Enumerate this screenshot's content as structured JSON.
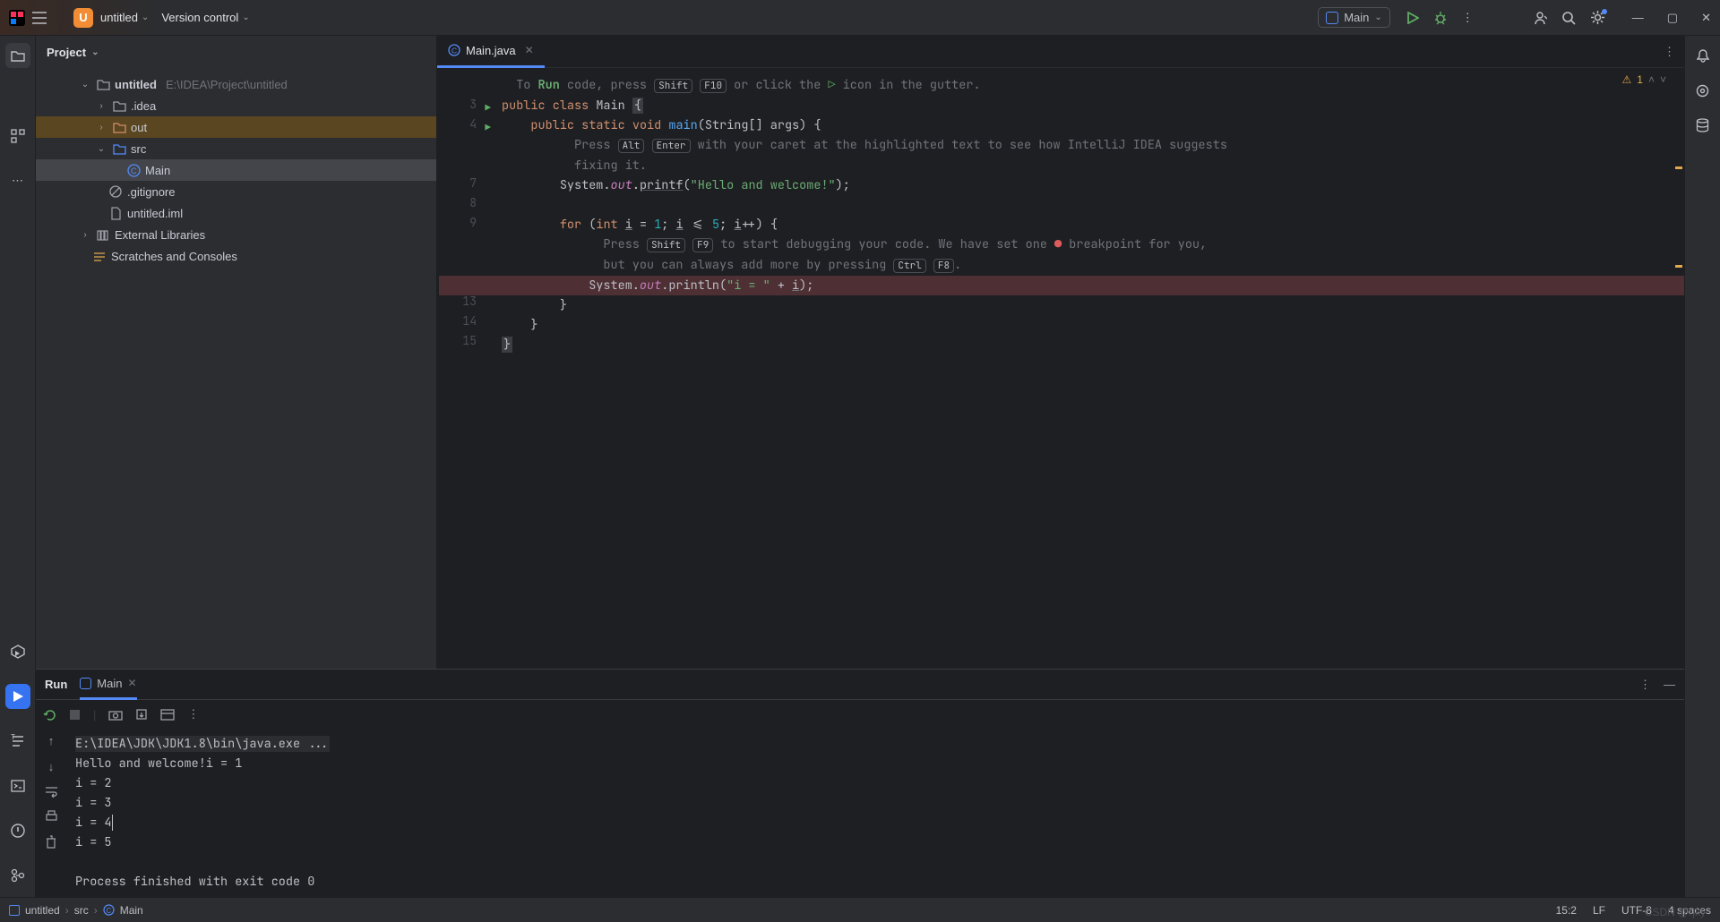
{
  "titlebar": {
    "project_initial": "U",
    "project_name": "untitled",
    "vcs_label": "Version control",
    "run_config": "Main"
  },
  "window": {
    "minimize": "—",
    "maximize": "▢",
    "close": "✕"
  },
  "project_tool": {
    "title": "Project",
    "root": {
      "name": "untitled",
      "path": "E:\\IDEA\\Project\\untitled"
    },
    "idea_folder": ".idea",
    "out_folder": "out",
    "src_folder": "src",
    "main_file": "Main",
    "gitignore": ".gitignore",
    "iml": "untitled.iml",
    "external_libs": "External Libraries",
    "scratches": "Scratches and Consoles"
  },
  "editor": {
    "tab_name": "Main.java",
    "inspection_count": "1",
    "hint_run": {
      "pre": "To ",
      "run": "Run",
      "mid": " code, press ",
      "k1": "Shift",
      "k2": "F10",
      "post": " or click the ",
      "post2": " icon in the gutter."
    },
    "hint_alt": {
      "pre": "Press ",
      "k1": "Alt",
      "k2": "Enter",
      "post": " with your caret at the highlighted text to see how IntelliJ IDEA suggests",
      "line2": "fixing it."
    },
    "hint_dbg": {
      "pre": "Press ",
      "k1": "Shift",
      "k2": "F9",
      "mid": " to start debugging your code. We have set one ",
      "mid2": " breakpoint for you,",
      "line2_pre": "but you can always add more by pressing ",
      "k3": "Ctrl",
      "k4": "F8",
      "dot": "."
    },
    "code": {
      "l3a": "public",
      "l3b": "class",
      "l3c": "Main",
      "l3d": "{",
      "l4a": "public",
      "l4b": "static",
      "l4c": "void",
      "l4d": "main",
      "l4e": "(String[] args) {",
      "l7a": "System.",
      "l7b": "out",
      "l7c": ".",
      "l7d": "printf",
      "l7e": "(",
      "l7f": "\"Hello and welcome!\"",
      "l7g": ");",
      "l9a": "for",
      "l9b": "(",
      "l9c": "int",
      "l9d": "i",
      "l9e": " = ",
      "l9f": "1",
      "l9g": "; ",
      "l9h": "i",
      "l9i": " <= ",
      "l9j": "5",
      "l9k": "; ",
      "l9l": "i",
      "l9m": "++) {",
      "l12a": "System.",
      "l12b": "out",
      "l12c": ".println(",
      "l12d": "\"i = \"",
      "l12e": " + ",
      "l12f": "i",
      "l12g": ");",
      "l13": "}",
      "l14": "}",
      "l15": "}"
    },
    "gutter": {
      "n3": "3",
      "n4": "4",
      "n7": "7",
      "n8": "8",
      "n9": "9",
      "n13": "13",
      "n14": "14",
      "n15": "15"
    }
  },
  "run": {
    "title": "Run",
    "tab": "Main",
    "console": {
      "cmd": "E:\\IDEA\\JDK\\JDK1.8\\bin\\java.exe ...",
      "l1": "Hello and welcome!i = 1",
      "l2": "i = 2",
      "l3": "i = 3",
      "l4": "i = 4",
      "l5": "i = 5",
      "exit": "Process finished with exit code 0"
    }
  },
  "breadcrumb": {
    "a": "untitled",
    "b": "src",
    "c": "Main"
  },
  "status": {
    "pos": "15:2",
    "le": "LF",
    "enc": "UTF-8",
    "indent": "4 spaces"
  },
  "watermark": "CSDN @rjky"
}
